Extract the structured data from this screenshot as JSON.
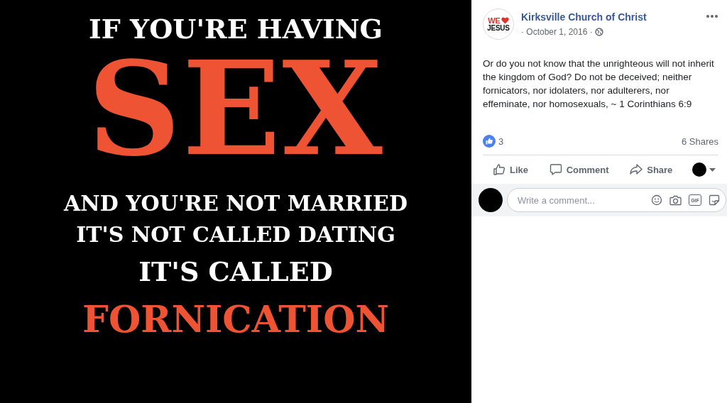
{
  "post_image": {
    "lines": [
      {
        "text": "IF YOU'RE HAVING",
        "kind": "large"
      },
      {
        "text": "SEX",
        "kind": "huge"
      },
      {
        "text": "AND YOU'RE NOT MARRIED",
        "kind": "medium"
      },
      {
        "text": "IT'S NOT CALLED DATING",
        "kind": "medium"
      },
      {
        "text": "IT'S CALLED",
        "kind": "large"
      },
      {
        "text": "FORNICATION",
        "kind": "accent"
      }
    ]
  },
  "page_avatar": {
    "top": "WE",
    "bottom": "JESUS"
  },
  "page_name": "Kirksville Church of Christ",
  "date": "· October 1, 2016 ·",
  "post_text": "Or do you not know that the unrighteous will not inherit the kingdom of God? Do not be deceived; neither fornicators, nor idolaters, nor adulterers, nor effeminate, nor homosexuals, ~ 1 Corinthians 6:9",
  "reactions": {
    "count": "3",
    "shares": "6 Shares"
  },
  "actions": [
    {
      "label": "Like",
      "kind": "like"
    },
    {
      "label": "Comment",
      "kind": "comment"
    },
    {
      "label": "Share",
      "kind": "share"
    }
  ],
  "comment_box": {
    "placeholder": "Write a comment...",
    "gif_label": "GIF"
  }
}
